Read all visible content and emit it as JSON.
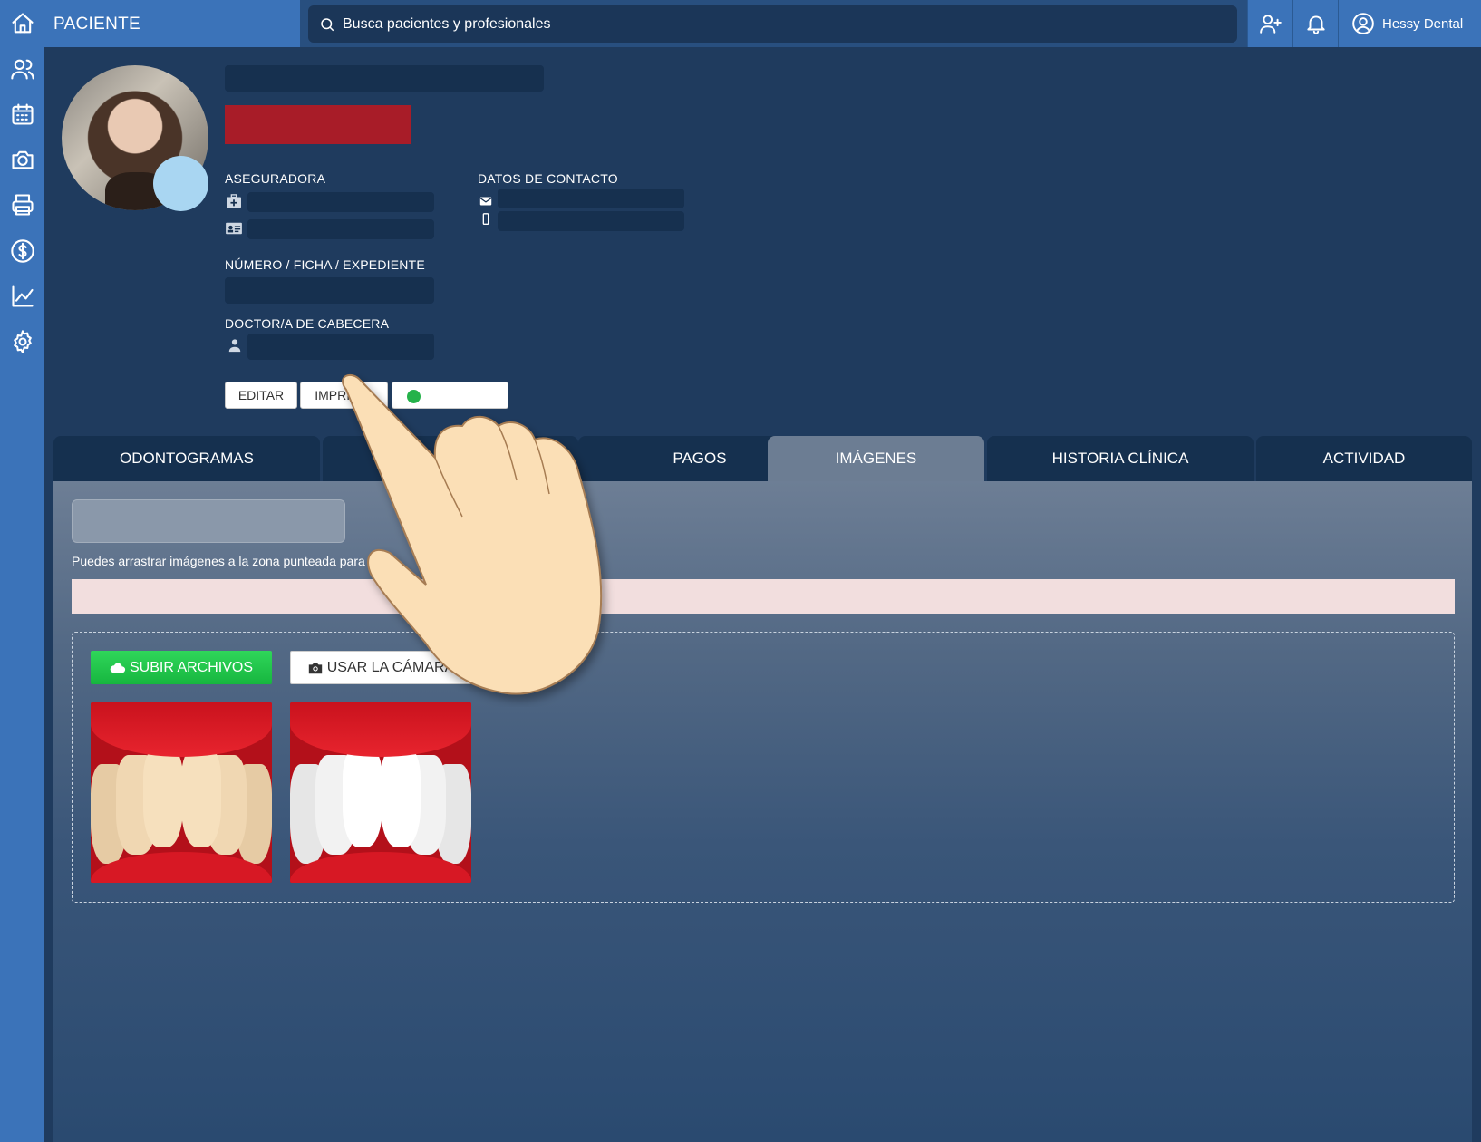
{
  "topbar": {
    "title": "PACIENTE",
    "search_placeholder": "Busca pacientes y profesionales",
    "user_name": "Hessy Dental"
  },
  "sidebar": {
    "items": [
      {
        "icon": "home-icon"
      },
      {
        "icon": "users-icon"
      },
      {
        "icon": "calendar-icon"
      },
      {
        "icon": "camera-icon"
      },
      {
        "icon": "printer-icon"
      },
      {
        "icon": "dollar-icon"
      },
      {
        "icon": "chart-icon"
      },
      {
        "icon": "gear-icon"
      }
    ]
  },
  "patient": {
    "insurer_label": "ASEGURADORA",
    "contact_label": "DATOS DE CONTACTO",
    "record_label": "NÚMERO / FICHA / EXPEDIENTE",
    "doctor_label": "DOCTOR/A DE CABECERA",
    "edit_label": "EDITAR",
    "print_label": "IMPRIMIR"
  },
  "tabs": [
    {
      "label": "ODONTOGRAMAS",
      "active": false
    },
    {
      "label": "",
      "active": false
    },
    {
      "label": "PAGOS",
      "active": false
    },
    {
      "label": "IMÁGENES",
      "active": true
    },
    {
      "label": "HISTORIA CLÍNICA",
      "active": false
    },
    {
      "label": "ACTIVIDAD",
      "active": false
    }
  ],
  "images_panel": {
    "hint": "Puedes arrastrar imágenes a la zona punteada para subir",
    "upload_label": "SUBIR ARCHIVOS",
    "camera_label": "USAR LA CÁMARA"
  },
  "colors": {
    "sidebar": "#3b73b9",
    "background": "#1f3b5e",
    "tab": "#15304f",
    "tab_active": "#6c7d93",
    "upload": "#22c54a",
    "whatsapp": "#25b24a"
  }
}
